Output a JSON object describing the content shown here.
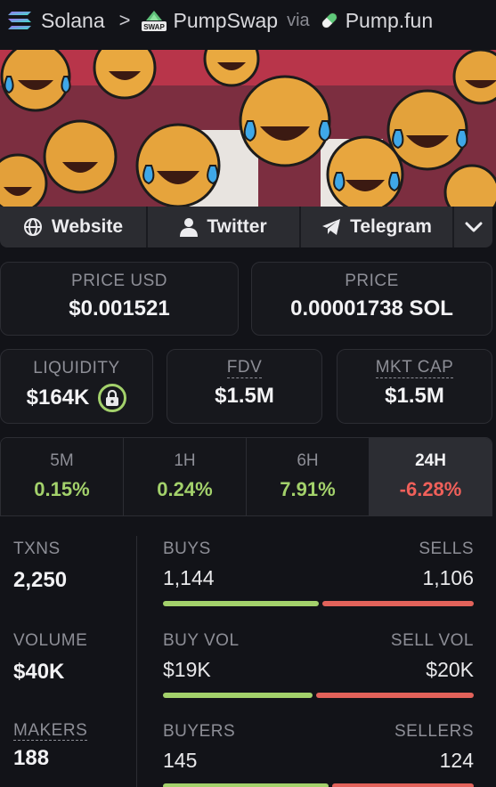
{
  "breadcrumb": {
    "chain": "Solana",
    "separator": ">",
    "dex": "PumpSwap",
    "dex_logo_text": "SWAP",
    "via": "via",
    "launchpad": "Pump.fun"
  },
  "banner": {
    "icon": "laughing-emoji-crowd"
  },
  "social": {
    "website": "Website",
    "twitter": "Twitter",
    "telegram": "Telegram",
    "more_icon": "chevron-down-icon"
  },
  "price": {
    "usd_label": "PRICE USD",
    "usd_value": "$0.001521",
    "native_label": "PRICE",
    "native_value": "0.00001738 SOL"
  },
  "metrics": {
    "liquidity_label": "LIQUIDITY",
    "liquidity_value": "$164K",
    "fdv_label": "FDV",
    "fdv_value": "$1.5M",
    "mcap_label": "MKT CAP",
    "mcap_value": "$1.5M"
  },
  "timeframes": [
    {
      "label": "5M",
      "change": "0.15%"
    },
    {
      "label": "1H",
      "change": "0.24%"
    },
    {
      "label": "6H",
      "change": "7.91%"
    },
    {
      "label": "24H",
      "change": "-6.28%"
    }
  ],
  "selected_timeframe": "24H",
  "txn_stats": {
    "txns": {
      "label": "TXNS",
      "value": "2,250"
    },
    "volume": {
      "label": "VOLUME",
      "value": "$40K"
    },
    "makers": {
      "label": "MAKERS",
      "value": "188"
    },
    "buys": {
      "label": "BUYS",
      "value": "1,144",
      "ratio": 0.508
    },
    "sells": {
      "label": "SELLS",
      "value": "1,106"
    },
    "buy_vol": {
      "label": "BUY VOL",
      "value": "$19K",
      "ratio": 0.486
    },
    "sell_vol": {
      "label": "SELL VOL",
      "value": "$20K"
    },
    "buyers": {
      "label": "BUYERS",
      "value": "145",
      "ratio": 0.539
    },
    "sellers": {
      "label": "SELLERS",
      "value": "124"
    }
  },
  "colors": {
    "positive": "#a3d16b",
    "negative": "#f0605a",
    "background": "#121318"
  }
}
